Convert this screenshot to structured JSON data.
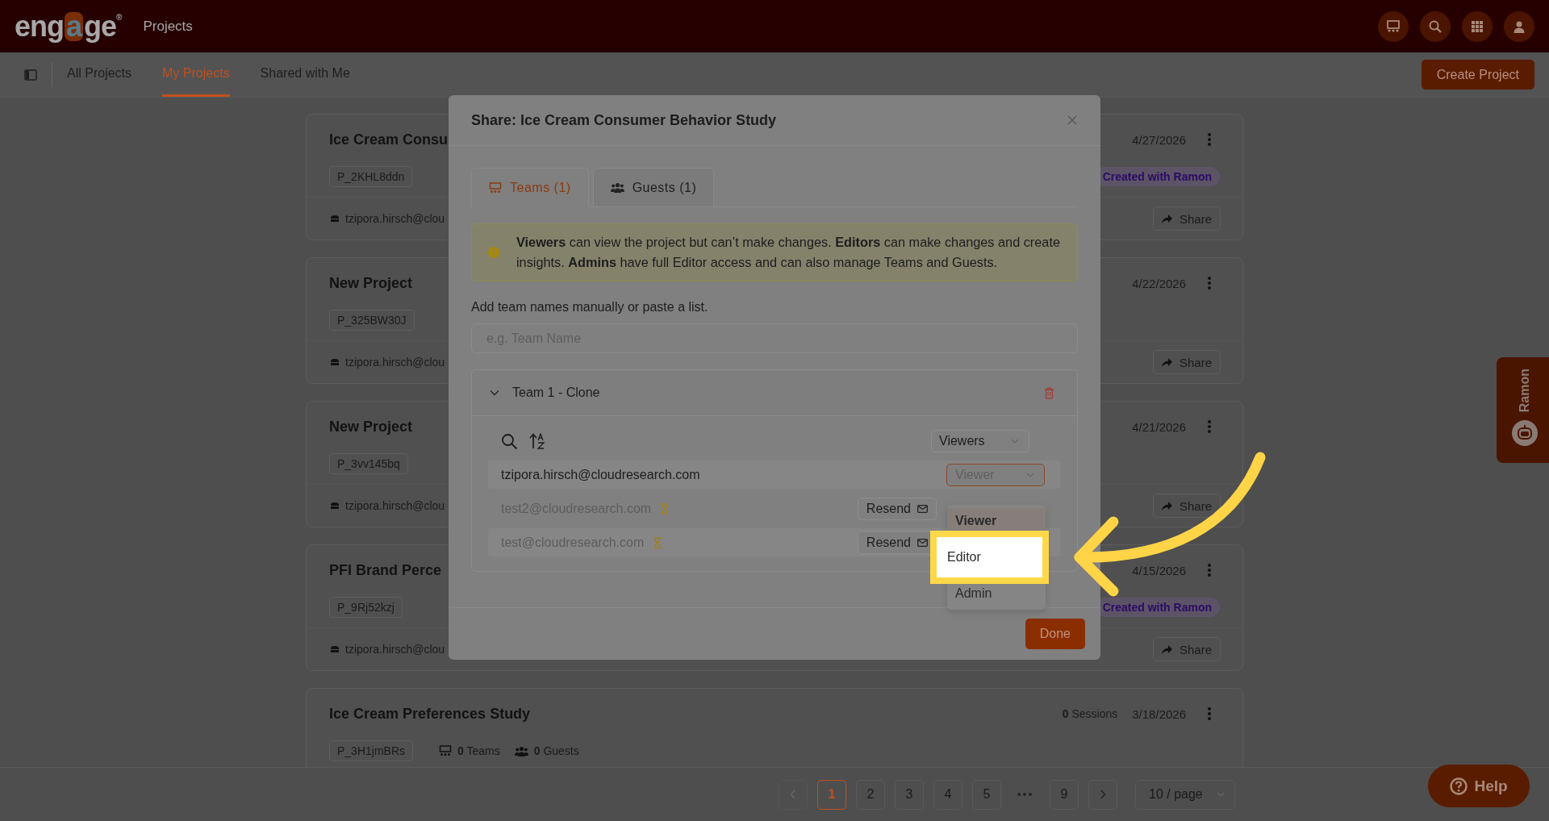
{
  "header": {
    "logo": {
      "text": "engage",
      "mark": "®"
    },
    "section": "Projects"
  },
  "nav": {
    "tabs": [
      {
        "label": "All Projects",
        "selected": false
      },
      {
        "label": "My Projects",
        "selected": true
      },
      {
        "label": "Shared with Me",
        "selected": false
      }
    ],
    "create_button": "Create Project"
  },
  "projects": [
    {
      "title": "Ice Cream Consu",
      "id": "P_2KHL8ddn",
      "owner": "tzipora.hirsch@clou",
      "date": "4/27/2026",
      "tag": "Created with Ramon",
      "share": "Share"
    },
    {
      "title": "New Project",
      "id": "P_325BW30J",
      "owner": "tzipora.hirsch@clou",
      "date": "4/22/2026",
      "share": "Share"
    },
    {
      "title": "New Project",
      "id": "P_3vv145bq",
      "owner": "tzipora.hirsch@clou",
      "date": "4/21/2026",
      "share": "Share"
    },
    {
      "title": "PFI Brand Perce",
      "id": "P_9Rj52kzj",
      "owner": "tzipora.hirsch@clou",
      "date": "4/15/2026",
      "tag": "Created with Ramon",
      "share": "Share"
    },
    {
      "title": "Ice Cream Preferences Study",
      "id": "P_3H1jmBRs",
      "teams": "**0** Teams",
      "guests": "**0** Guests",
      "sessions": "**0** Sessions",
      "date": "3/18/2026"
    }
  ],
  "modal": {
    "title": "Share: Ice Cream Consumer Behavior Study",
    "tabs": [
      {
        "label": "Teams (1)",
        "kind": "teams",
        "selected": true
      },
      {
        "label": "Guests (1)",
        "kind": "guests",
        "selected": false
      }
    ],
    "notice": "**Viewers** can view the project but can’t make changes. **Editors** can make changes and create insights. **Admins** have full Editor access and can also manage Teams and Guests.",
    "input_label": "Add team names manually or paste a list.",
    "input": {
      "placeholder": "e.g. Team Name"
    },
    "team": {
      "name": "Team 1 - Clone",
      "expanded": true,
      "filter": "Viewers",
      "members": [
        {
          "email": "tzipora.hirsch@cloudresearch.com",
          "pending": false,
          "role": "Viewer"
        },
        {
          "email": "test2@cloudresearch.com",
          "pending": true,
          "resend": "Resend"
        },
        {
          "email": "test@cloudresearch.com",
          "pending": true,
          "resend": "Resend"
        }
      ],
      "role_menu": [
        {
          "label": "Viewer",
          "selected": true,
          "highlighted": false
        },
        {
          "label": "Editor",
          "selected": false,
          "highlighted": true
        },
        {
          "label": "Admin",
          "selected": false,
          "highlighted": false
        }
      ]
    },
    "done": "Done"
  },
  "ramon_tab": {
    "label": "Ramon"
  },
  "help_button": {
    "label": "Help"
  },
  "pagination": {
    "prev_disabled": true,
    "next_disabled": false,
    "pages": [
      {
        "label": "1",
        "kind": "page",
        "selected": true
      },
      {
        "label": "2",
        "kind": "page",
        "selected": false
      },
      {
        "label": "3",
        "kind": "page",
        "selected": false
      },
      {
        "label": "4",
        "kind": "page",
        "selected": false
      },
      {
        "label": "5",
        "kind": "page",
        "selected": false
      },
      {
        "label": "•••",
        "kind": "ellipsis"
      },
      {
        "label": "9",
        "kind": "page",
        "selected": false
      }
    ],
    "per_page": "10 / page"
  }
}
